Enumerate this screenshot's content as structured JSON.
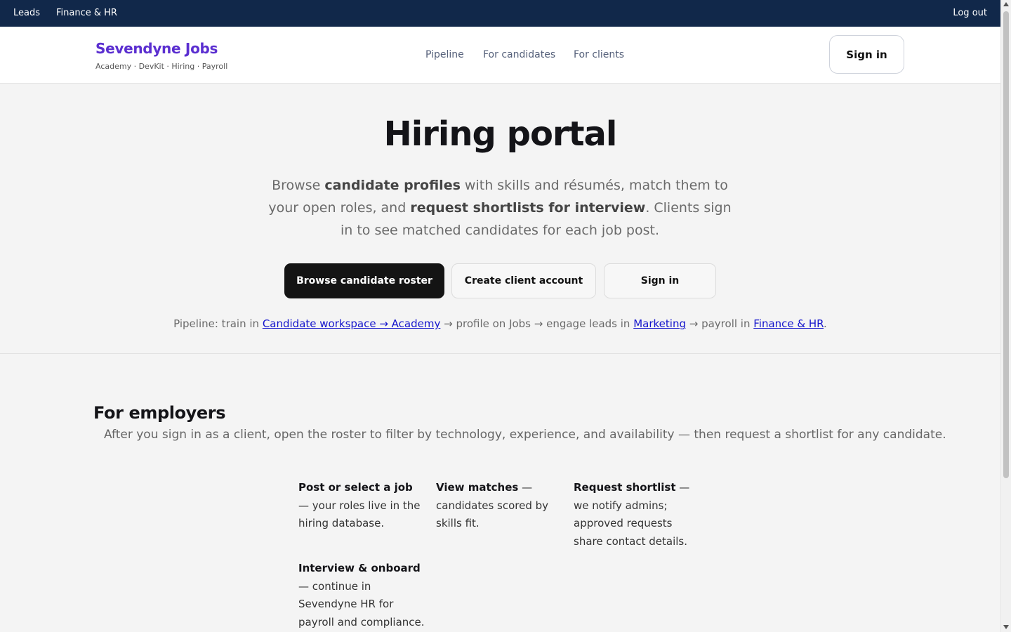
{
  "topbar": {
    "leads": "Leads",
    "finance_hr": "Finance & HR",
    "logout": "Log out"
  },
  "header": {
    "brand": "Sevendyne Jobs",
    "brand_sub": "Academy · DevKit · Hiring · Payroll",
    "nav": [
      "Pipeline",
      "For candidates",
      "For clients"
    ],
    "signin": "Sign in"
  },
  "hero": {
    "title": "Hiring portal",
    "desc": {
      "t1": "Browse ",
      "b1": "candidate profiles",
      "t2": " with skills and résumés, match them to your open roles, and ",
      "b2": "request shortlists for interview",
      "t3": ". Clients sign in to see matched candidates for each job post."
    },
    "buttons": {
      "browse": "Browse candidate roster",
      "create": "Create client account",
      "signin": "Sign in"
    },
    "pipeline": {
      "t1": "Pipeline: train in ",
      "link1": "Candidate workspace → Academy",
      "t2": " → profile on Jobs → engage leads in ",
      "link2": "Marketing",
      "t3": " → payroll in ",
      "link3": "Finance & HR",
      "t4": "."
    }
  },
  "employers": {
    "title": "For employers",
    "desc": "After you sign in as a client, open the roster to filter by technology, experience, and availability — then request a shortlist for any candidate.",
    "steps": [
      {
        "title": "Post or select a job",
        "text": " — your roles live in the hiring database."
      },
      {
        "title": "View matches",
        "text": " — candidates scored by skills fit."
      },
      {
        "title": "Request shortlist",
        "text": " — we notify admins; approved requests share contact details."
      },
      {
        "title": "Interview & onboard",
        "text": " — continue in Sevendyne HR for payroll and compliance."
      }
    ]
  },
  "colors": {
    "topbar_bg": "#11284a",
    "brand": "#5b2fd0",
    "primary_button": "#141414",
    "link": "#1414cc"
  }
}
